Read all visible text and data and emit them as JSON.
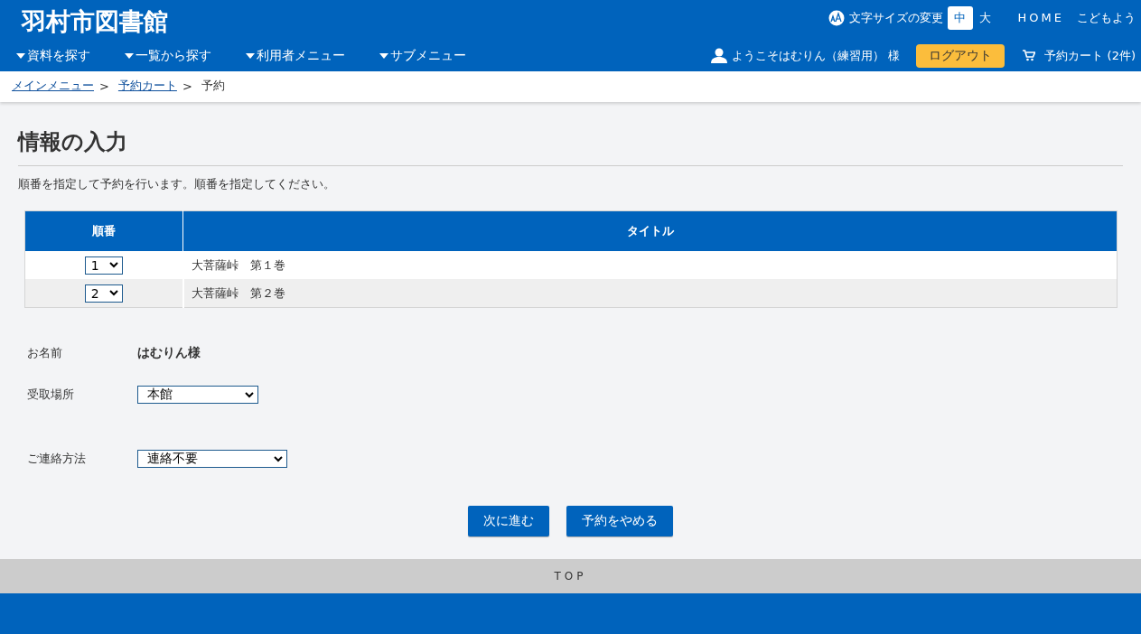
{
  "header": {
    "site_title": "羽村市図書館",
    "font_size": {
      "label": "文字サイズの変更",
      "options": [
        {
          "label": "中",
          "selected": true
        },
        {
          "label": "大",
          "selected": false
        }
      ]
    },
    "links": [
      "HOME",
      "こどもよう"
    ],
    "nav": [
      "資料を探す",
      "一覧から探す",
      "利用者メニュー",
      "サブメニュー"
    ],
    "welcome": "ようこそはむりん（練習用） 様",
    "logout": "ログアウト",
    "cart": "予約カート (2件)"
  },
  "breadcrumb": [
    {
      "label": "メインメニュー",
      "link": true,
      "separator": ">"
    },
    {
      "label": "予約カート",
      "link": true,
      "separator": ">"
    },
    {
      "label": "予約",
      "link": false
    }
  ],
  "page": {
    "title": "情報の入力",
    "description": "順番を指定して予約を行います。順番を指定してください。"
  },
  "table": {
    "columns": [
      "順番",
      "タイトル"
    ],
    "rows": [
      {
        "order": "1",
        "title": "大菩薩峠　第１巻"
      },
      {
        "order": "2",
        "title": "大菩薩峠　第２巻"
      }
    ]
  },
  "form": [
    {
      "label": "お名前",
      "kind": "text",
      "value": "はむりん様"
    },
    {
      "label": "受取場所",
      "kind": "select",
      "value": "本館"
    },
    {
      "label": "ご連絡方法",
      "kind": "select",
      "value": "連絡不要"
    }
  ],
  "buttons": [
    "次に進む",
    "予約をやめる"
  ],
  "footer": {
    "top_link": "TOP"
  }
}
